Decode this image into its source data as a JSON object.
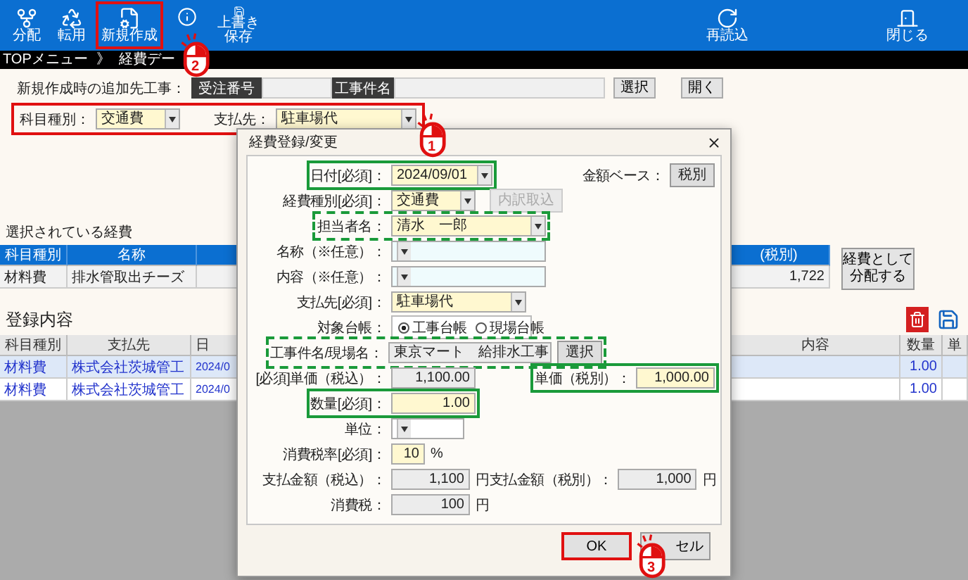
{
  "toolbar": {
    "left": [
      {
        "kind": "fork",
        "label": "分配",
        "highlighted": false
      },
      {
        "kind": "recycle",
        "label": "転用",
        "highlighted": false
      },
      {
        "kind": "new",
        "label": "新規作成",
        "highlighted": true
      },
      {
        "kind": "info",
        "highlighted": false
      },
      {
        "kind": "save",
        "label": "上書き保存",
        "highlighted": false
      }
    ],
    "right": [
      {
        "kind": "reload",
        "label": "再読込"
      },
      {
        "kind": "close",
        "label": "閉じる"
      }
    ]
  },
  "breadcrumb": [
    "TOPメニュー",
    "》",
    "経費デー"
  ],
  "target_project": {
    "label": "新規作成時の追加先工事：",
    "order_header": "受注番号",
    "name_header": "工事件名",
    "buttons": [
      "選択",
      "開く"
    ]
  },
  "filter": {
    "highlighted": true,
    "fields": [
      {
        "label": "科目種別：",
        "value": "交通費"
      },
      {
        "label": "支払先：",
        "value": "駐車場代"
      }
    ]
  },
  "selected_expenses": {
    "title": "選択されている経費",
    "columns": [
      "科目種別",
      "名称",
      "(税別)"
    ],
    "rows": [
      [
        "材料費",
        "排水管取出チーズ",
        "1,722"
      ]
    ],
    "button": "経費として分配する"
  },
  "registered": {
    "title": "登録内容",
    "columns": [
      "科目種別",
      "支払先",
      "日",
      "内容",
      "数量",
      "単"
    ],
    "rows": [
      {
        "selected": true,
        "cells": [
          "材料費",
          "株式会社茨城管工",
          "2024/0",
          null,
          "1.00",
          null
        ]
      },
      {
        "selected": false,
        "cells": [
          "材料費",
          "株式会社茨城管工",
          "2024/0",
          null,
          "1.00",
          null
        ]
      }
    ]
  },
  "dialog": {
    "title": "経費登録/変更",
    "rows": [
      {
        "kind": "select",
        "label": "日付[必須]：",
        "value": "2024/09/01",
        "color": "#fff8d0",
        "highlighted": true,
        "dashed": false,
        "side": {
          "kind": "button",
          "label": "金額ベース：",
          "button": "税別",
          "disabled": false
        }
      },
      {
        "kind": "select",
        "label": "経費種別[必須]：",
        "value": "交通費",
        "color": "#fff8d0",
        "highlighted": false,
        "side": {
          "kind": "button",
          "button": "内訳取込",
          "disabled": true
        }
      },
      {
        "kind": "select",
        "label": "担当者名：",
        "value": "清水　一郎",
        "color": "#fff8d0",
        "highlighted": true,
        "dashed": true
      },
      {
        "kind": "select",
        "label": "名称（※任意）：",
        "color": "#effbfd",
        "highlighted": false
      },
      {
        "kind": "select",
        "label": "内容（※任意）：",
        "color": "#effbfd",
        "highlighted": false
      },
      {
        "kind": "select",
        "label": "支払先[必須]：",
        "value": "駐車場代",
        "color": "#fff8d0",
        "highlighted": false
      },
      {
        "kind": "radio",
        "label": "対象台帳：",
        "highlighted": false,
        "options": [
          {
            "label": "工事台帳",
            "selected": true
          },
          {
            "label": "現場台帳",
            "selected": false
          }
        ]
      },
      {
        "kind": "text-button",
        "label": "工事件名/現場名：",
        "value": "東京マート　給排水工事",
        "color": "#ececec",
        "highlighted": true,
        "dashed": true,
        "button": "選択"
      },
      {
        "kind": "number",
        "prefix": "[必須]",
        "label": "単価（税込）：",
        "value": "1,100.00",
        "color": "#ececec",
        "highlighted": false,
        "side": {
          "kind": "field",
          "label": "単価（税別）：",
          "value": "1,000.00",
          "color": "#fff8d0",
          "highlighted": true,
          "dashed": false
        }
      },
      {
        "kind": "number",
        "label": "数量[必須]：",
        "value": "1.00",
        "color": "#fff8d0",
        "highlighted": true,
        "dashed": false
      },
      {
        "kind": "select",
        "label": "単位：",
        "color": "#ffffff",
        "highlighted": false
      },
      {
        "kind": "number",
        "label": "消費税率[必須]：",
        "value": "10",
        "color": "#fff8d0",
        "highlighted": false,
        "unit": "%"
      },
      {
        "kind": "number",
        "label": "支払金額（税込）：",
        "value": "1,100",
        "color": "#ececec",
        "highlighted": false,
        "unit": "円",
        "side": {
          "kind": "field",
          "label": "支払金額（税別）：",
          "value": "1,000",
          "color": "#ececec",
          "highlighted": false,
          "unit": "円"
        }
      },
      {
        "kind": "number",
        "label": "消費税：",
        "value": "100",
        "color": "#ececec",
        "highlighted": false,
        "unit": "円"
      }
    ],
    "buttons": [
      {
        "label": "OK",
        "highlighted": true
      },
      {
        "label": "セル",
        "highlighted": false
      }
    ]
  },
  "markers": [
    {
      "step": "1"
    },
    {
      "step": "2"
    },
    {
      "step": "3"
    }
  ]
}
